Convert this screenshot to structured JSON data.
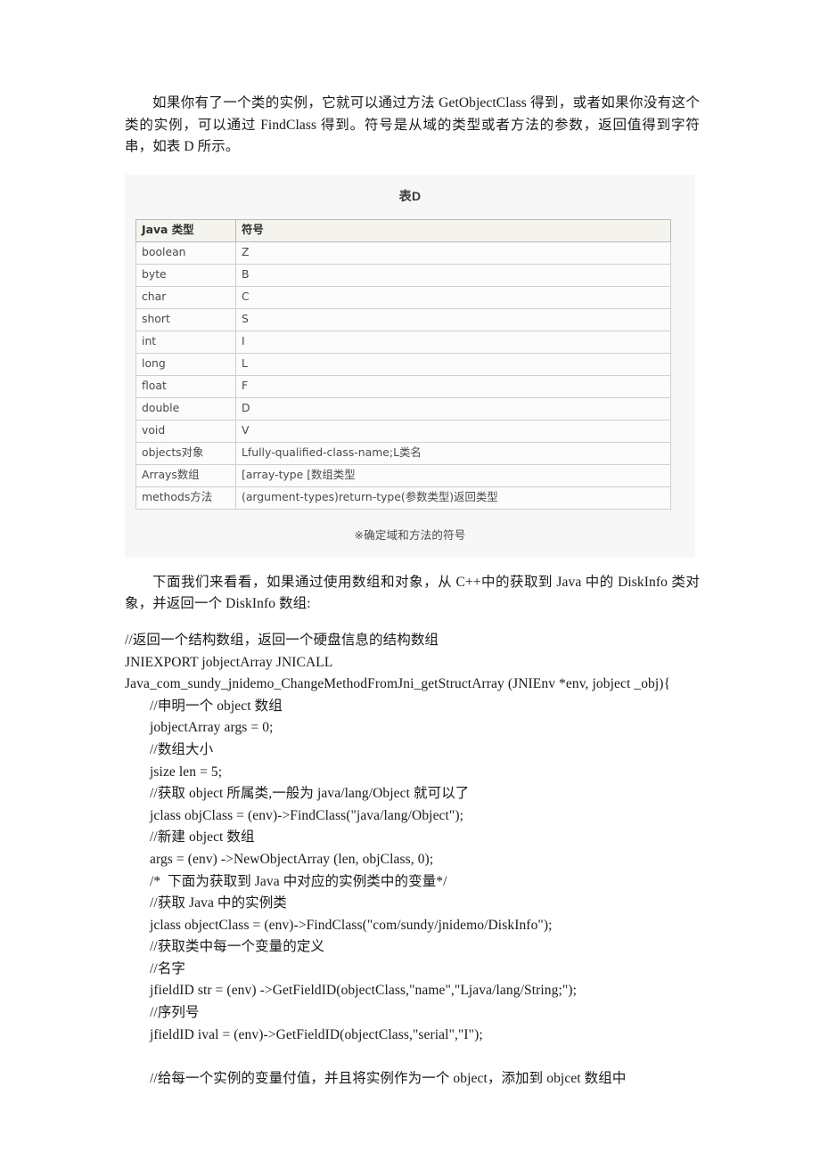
{
  "document": {
    "paragraphs": {
      "intro": "如果你有了一个类的实例，它就可以通过方法 GetObjectClass 得到，或者如果你没有这个类的实例，可以通过 FindClass 得到。符号是从域的类型或者方法的参数，返回值得到字符串，如表 D 所示。",
      "after_table": "下面我们来看看，如果通过使用数组和对象，从 C++中的获取到 Java 中的 DiskInfo 类对象，并返回一个 DiskInfo 数组:"
    },
    "figure": {
      "title": "表D",
      "caption": "※确定域和方法的符号",
      "table": {
        "headers": [
          "Java 类型",
          "符号"
        ],
        "rows": [
          [
            "boolean",
            "Z"
          ],
          [
            "byte",
            "B"
          ],
          [
            "char",
            "C"
          ],
          [
            "short",
            "S"
          ],
          [
            "int",
            "I"
          ],
          [
            "long",
            "L"
          ],
          [
            "float",
            "F"
          ],
          [
            "double",
            "D"
          ],
          [
            "void",
            "V"
          ],
          [
            "objects对象",
            "Lfully-qualified-class-name;L类名"
          ],
          [
            "Arrays数组",
            "[array-type [数组类型"
          ],
          [
            "methods方法",
            "(argument-types)return-type(参数类型)返回类型"
          ]
        ]
      }
    },
    "code": {
      "lines": [
        {
          "text": "//返回一个结构数组，返回一个硬盘信息的结构数组",
          "indent": 0
        },
        {
          "text": "JNIEXPORT jobjectArray JNICALL",
          "indent": 0
        },
        {
          "text": "Java_com_sundy_jnidemo_ChangeMethodFromJni_getStructArray (JNIEnv *env, jobject _obj){",
          "indent": 0
        },
        {
          "text": "//申明一个 object 数组",
          "indent": 1
        },
        {
          "text": "jobjectArray args = 0;",
          "indent": 1
        },
        {
          "text": "//数组大小",
          "indent": 1
        },
        {
          "text": "jsize len = 5;",
          "indent": 1
        },
        {
          "text": "//获取 object 所属类,一般为 java/lang/Object 就可以了",
          "indent": 1
        },
        {
          "text": "jclass objClass = (env)->FindClass(\"java/lang/Object\");",
          "indent": 1
        },
        {
          "text": "//新建 object 数组",
          "indent": 1
        },
        {
          "text": "args = (env) ->NewObjectArray (len, objClass, 0);",
          "indent": 1
        },
        {
          "text": "/*  下面为获取到 Java 中对应的实例类中的变量*/",
          "indent": 1
        },
        {
          "text": "//获取 Java 中的实例类",
          "indent": 1
        },
        {
          "text": "jclass objectClass = (env)->FindClass(\"com/sundy/jnidemo/DiskInfo\");",
          "indent": 1
        },
        {
          "text": "//获取类中每一个变量的定义",
          "indent": 1
        },
        {
          "text": "//名字",
          "indent": 1
        },
        {
          "text": "jfieldID str = (env) ->GetFieldID(objectClass,\"name\",\"Ljava/lang/String;\");",
          "indent": 1
        },
        {
          "text": "//序列号",
          "indent": 1
        },
        {
          "text": "jfieldID ival = (env)->GetFieldID(objectClass,\"serial\",\"I\");",
          "indent": 1
        },
        {
          "text": "",
          "indent": 1
        },
        {
          "text": "//给每一个实例的变量付值，并且将实例作为一个 object，添加到 objcet 数组中",
          "indent": 1
        }
      ]
    }
  }
}
